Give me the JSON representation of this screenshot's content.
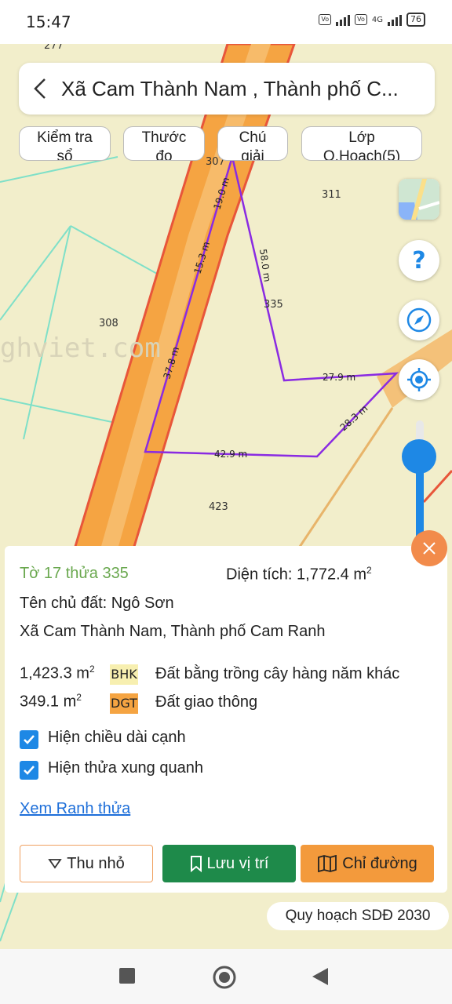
{
  "status": {
    "time": "15:47",
    "network": "4G",
    "battery": "76",
    "volte": "Vo LTE"
  },
  "search": {
    "title": "Xã Cam Thành Nam , Thành phố C..."
  },
  "chips": [
    {
      "line1": "Kiểm tra",
      "line2": "sổ"
    },
    {
      "line1": "Thước",
      "line2": "đo"
    },
    {
      "line1": "Chú",
      "line2": "giải"
    },
    {
      "line1": "Lớp",
      "line2": "Q.Hoạch(5)"
    }
  ],
  "map": {
    "parcels": [
      "277",
      "307",
      "311",
      "335",
      "308",
      "423"
    ],
    "edges": [
      "19.0 m",
      "15.3 m",
      "58.0 m",
      "37.8 m",
      "27.9 m",
      "28.3 m",
      "42.9 m"
    ],
    "watermark": "ghviet.com",
    "colors": {
      "land": "#f2eecb",
      "road": "#f5a442",
      "road_border": "#e8563a",
      "boundary": "#8a2be2",
      "grid": "#7fe0c8"
    }
  },
  "panel": {
    "sheet_parcel": "Tờ 17 thửa 335",
    "area_label": "Diện tích: 1,772.4 m",
    "area_sup": "2",
    "owner": "Tên chủ đất: Ngô Sơn",
    "address": "Xã Cam Thành Nam, Thành phố Cam Ranh",
    "land_uses": [
      {
        "area": "1,423.3 m",
        "sup": "2",
        "code": "BHK",
        "desc": "Đất bằng trồng cây hàng năm khác",
        "color": "#f7efb0"
      },
      {
        "area": "349.1 m",
        "sup": "2",
        "code": "DGT",
        "desc": "Đất giao thông",
        "color": "#f5a442"
      }
    ],
    "checks": [
      {
        "label": "Hiện chiều dài cạnh",
        "checked": true
      },
      {
        "label": "Hiện thửa xung quanh",
        "checked": true
      }
    ],
    "link": "Xem Ranh thửa"
  },
  "buttons": {
    "collapse": "Thu nhỏ",
    "save": "Lưu vị trí",
    "directions": "Chỉ đường"
  },
  "plan_label": "Quy hoạch SDĐ 2030"
}
